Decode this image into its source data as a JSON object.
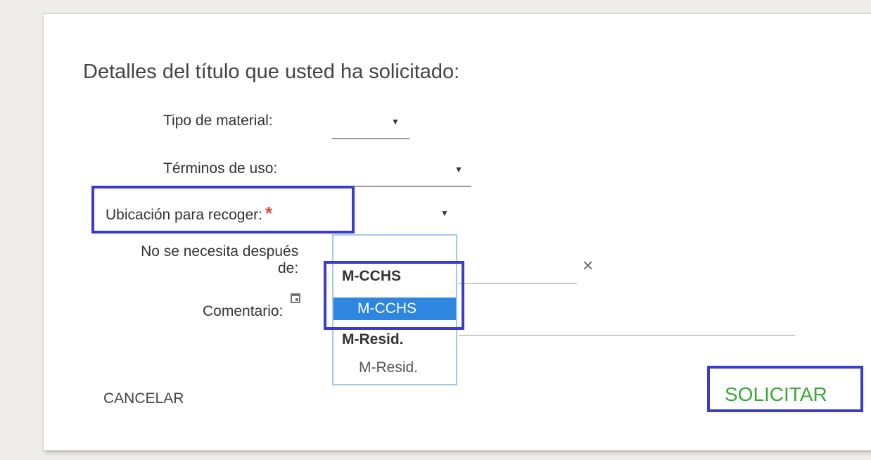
{
  "form": {
    "heading": "Detalles del título que usted ha solicitado:",
    "material_type_label": "Tipo de material:",
    "terms_label": "Términos de uso:",
    "pickup_label": "Ubicación para recoger:",
    "required_marker": "*",
    "not_needed_label_line1": "No se necesita después",
    "not_needed_label_line2": "de:",
    "comment_label": "Comentario:",
    "clear_symbol": "×"
  },
  "pickup_dropdown": {
    "groups": [
      {
        "label": "M-CCHS",
        "option": "M-CCHS",
        "selected": true
      },
      {
        "label": "M-Resid.",
        "option": "M-Resid.",
        "selected": false
      }
    ]
  },
  "actions": {
    "cancel_label": "CANCELAR",
    "submit_label": "SOLICITAR"
  },
  "colors": {
    "highlight": "#3c3ccc",
    "selected_option": "#2f86e0",
    "submit_text": "#3aa63a",
    "required": "#e8472b"
  },
  "icons": {
    "caret": "caret-down-icon",
    "clear": "close-icon",
    "calendar": "calendar-icon"
  }
}
